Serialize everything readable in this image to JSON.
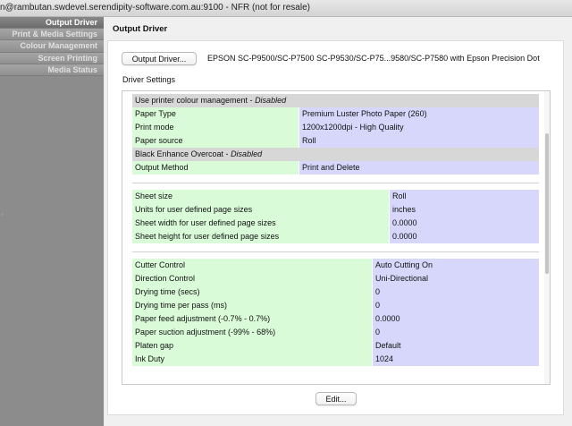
{
  "window": {
    "title": "n@rambutan.swdevel.serendipity-software.com.au:9100 - NFR (not for resale)"
  },
  "sidebar": {
    "items": [
      {
        "label": "Output Driver",
        "active": true
      },
      {
        "label": "Print & Media Settings",
        "active": false
      },
      {
        "label": "Colour Management",
        "active": false
      },
      {
        "label": "Screen Printing",
        "active": false
      },
      {
        "label": "Media Status",
        "active": false
      }
    ]
  },
  "main": {
    "heading": "Output Driver",
    "output_driver_button": "Output Driver...",
    "printer_name": "EPSON SC-P9500/SC-P7500 SC-P9530/SC-P75...9580/SC-P7580  with Epson Precision Dot",
    "driver_settings_label": "Driver Settings",
    "edit_button": "Edit..."
  },
  "settings": {
    "group1": [
      {
        "name": "Use printer colour management - ",
        "em": "Disabled",
        "single": true
      },
      {
        "name": "Paper Type",
        "value": "Premium Luster Photo Paper (260)"
      },
      {
        "name": "Print mode",
        "value": "1200x1200dpi - High Quality"
      },
      {
        "name": "Paper source",
        "value": "Roll"
      },
      {
        "name": "Black Enhance Overcoat - ",
        "em": "Disabled",
        "single": true
      },
      {
        "name": "Output Method",
        "value": "Print and Delete"
      }
    ],
    "group2": [
      {
        "name": "Sheet size",
        "value": "Roll"
      },
      {
        "name": "Units for user defined page sizes",
        "value": "inches"
      },
      {
        "name": "Sheet width for user defined page sizes",
        "value": "0.0000"
      },
      {
        "name": "Sheet height for user defined page sizes",
        "value": "0.0000"
      }
    ],
    "group3": [
      {
        "name": "Cutter Control",
        "value": "Auto Cutting On"
      },
      {
        "name": "Direction Control",
        "value": "Uni-Directional"
      },
      {
        "name": "Drying time (secs)",
        "value": "0"
      },
      {
        "name": "Drying time per pass (ms)",
        "value": "0"
      },
      {
        "name": "Paper feed adjustment (-0.7% - 0.7%)",
        "value": "0.0000"
      },
      {
        "name": "Paper suction adjustment (-99% - 68%)",
        "value": "0"
      },
      {
        "name": "Platen gap",
        "value": "Default"
      },
      {
        "name": "Ink Duty",
        "value": "1024"
      }
    ]
  },
  "colors": {
    "name_cell": "#d9fbd8",
    "value_cell": "#d7d7fc",
    "header_row": "#d7d7d7",
    "sidebar": "#8c8c8c"
  }
}
